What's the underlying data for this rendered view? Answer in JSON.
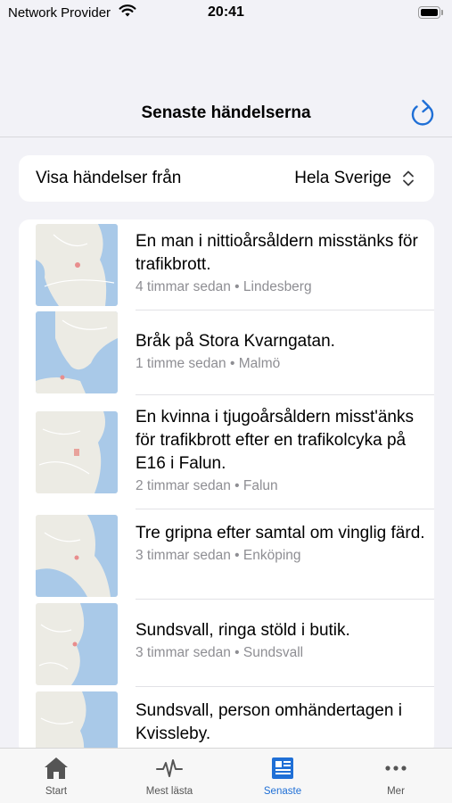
{
  "status_bar": {
    "carrier": "Network Provider",
    "time": "20:41"
  },
  "nav": {
    "title": "Senaste händelserna"
  },
  "filter": {
    "label": "Visa händelser från",
    "value": "Hela Sverige"
  },
  "events": [
    {
      "title": "En man i nittioårsåldern misstänks för trafikbrott.",
      "time_ago": "4 timmar sedan",
      "location": "Lindesberg"
    },
    {
      "title": "Bråk på Stora Kvarngatan.",
      "time_ago": "1 timme sedan",
      "location": "Malmö"
    },
    {
      "title": "En kvinna i tjugoårsåldern misst'änks för trafikbrott efter en trafikolcyka på E16 i Falun.",
      "time_ago": "2 timmar sedan",
      "location": "Falun"
    },
    {
      "title": "Tre gripna efter samtal om vinglig färd.",
      "time_ago": "3 timmar sedan",
      "location": "Enköping"
    },
    {
      "title": "Sundsvall, ringa stöld i butik.",
      "time_ago": "3 timmar sedan",
      "location": "Sundsvall"
    },
    {
      "title": "Sundsvall, person omhändertagen i Kvissleby.",
      "time_ago": "",
      "location": ""
    }
  ],
  "meta_separator": "•",
  "tabs": [
    {
      "label": "Start",
      "icon": "house-icon"
    },
    {
      "label": "Mest lästa",
      "icon": "pulse-icon"
    },
    {
      "label": "Senaste",
      "icon": "newspaper-icon"
    },
    {
      "label": "Mer",
      "icon": "more-icon"
    }
  ],
  "active_tab": "Senaste",
  "colors": {
    "accent": "#1f6fd6",
    "background": "#f2f2f7",
    "secondary_text": "#8e8e93",
    "map_water": "#a9c9e8",
    "map_land": "#ecebe4"
  }
}
